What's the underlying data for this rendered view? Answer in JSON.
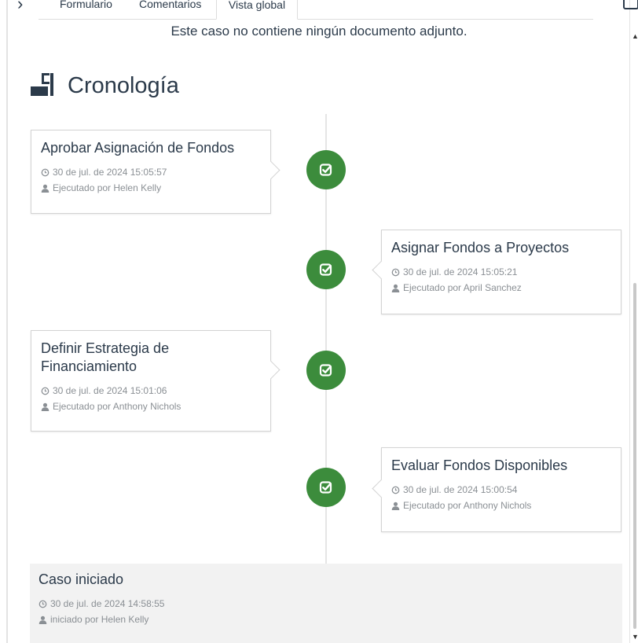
{
  "tabs": {
    "form": "Formulario",
    "comments": "Comentarios",
    "global": "Vista global"
  },
  "documents": {
    "empty_text": "Este caso no contiene ningún documento adjunto."
  },
  "timeline": {
    "title": "Cronología",
    "events": [
      {
        "title": "Aprobar Asignación de Fondos",
        "date": "30 de jul. de 2024 15:05:57",
        "executed_by": "Ejecutado por Helen Kelly",
        "side": "left"
      },
      {
        "title": "Asignar Fondos a Proyectos",
        "date": "30 de jul. de 2024 15:05:21",
        "executed_by": "Ejecutado por April Sanchez",
        "side": "right"
      },
      {
        "title": "Definir Estrategia de Financiamiento",
        "date": "30 de jul. de 2024 15:01:06",
        "executed_by": "Ejecutado por Anthony Nichols",
        "side": "left"
      },
      {
        "title": "Evaluar Fondos Disponibles",
        "date": "30 de jul. de 2024 15:00:54",
        "executed_by": "Ejecutado por Anthony Nichols",
        "side": "right"
      }
    ],
    "start": {
      "title": "Caso iniciado",
      "date": "30 de jul. de 2024 14:58:55",
      "started_by": "iniciado por Helen Kelly"
    }
  },
  "colors": {
    "task_complete_badge": "#3c8c3c",
    "text_primary": "#2b3a4a",
    "text_meta": "#8a8f94"
  },
  "icons": {
    "badge": "task-complete-icon",
    "date": "clock-icon",
    "user": "user-icon",
    "section": "timeline-icon"
  }
}
